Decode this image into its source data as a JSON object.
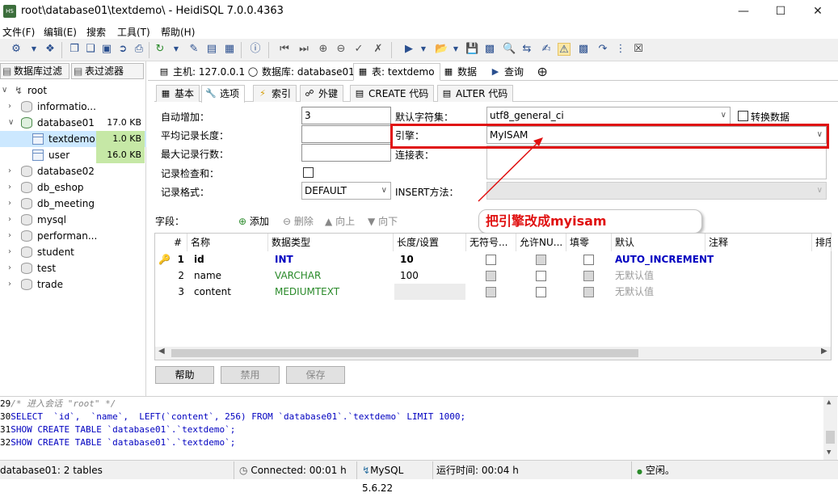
{
  "window": {
    "title": "root\\database01\\textdemo\\ - HeidiSQL 7.0.0.4363",
    "icon": "HS"
  },
  "menu": [
    "文件(F)",
    "编辑(E)",
    "搜索",
    "工具(T)",
    "帮助(H)"
  ],
  "filters": {
    "db_filter": "数据库过滤",
    "table_filter": "表过滤器"
  },
  "tree": [
    {
      "label": "root"
    },
    {
      "label": "informatio...",
      "size": ""
    },
    {
      "label": "database01",
      "size": "17.0 KB"
    },
    {
      "label": "textdemo",
      "size": "1.0 KB"
    },
    {
      "label": "user",
      "size": "16.0 KB"
    },
    {
      "label": "database02",
      "size": ""
    },
    {
      "label": "db_eshop",
      "size": ""
    },
    {
      "label": "db_meeting",
      "size": ""
    },
    {
      "label": "mysql",
      "size": ""
    },
    {
      "label": "performan...",
      "size": ""
    },
    {
      "label": "student",
      "size": ""
    },
    {
      "label": "test",
      "size": ""
    },
    {
      "label": "trade",
      "size": ""
    }
  ],
  "main_tabs": [
    "主机: 127.0.0.1",
    "数据库: database01",
    "表: textdemo",
    "数据",
    "查询"
  ],
  "sub_tabs": [
    "基本",
    "选项",
    "索引",
    "外键",
    "CREATE 代码",
    "ALTER 代码"
  ],
  "options": {
    "auto_increment_label": "自动增加：",
    "auto_increment_value": "3",
    "avg_row_label": "平均记录长度：",
    "max_rows_label": "最大记录行数：",
    "checksum_label": "记录检查和：",
    "row_format_label": "记录格式：",
    "row_format_value": "DEFAULT",
    "charset_label": "默认字符集：",
    "charset_value": "utf8_general_ci",
    "convert_label": "转换数据",
    "engine_label": "引擎：",
    "engine_value": "MyISAM",
    "union_label": "连接表：",
    "insert_method_label": "INSERT方法："
  },
  "annotation": {
    "text": "把引擎改成myisam",
    "color": "#ff0000"
  },
  "fields_toolbar": {
    "label": "字段：",
    "add": "添加",
    "remove": "删除",
    "up": "向上",
    "down": "向下"
  },
  "grid": {
    "headers": [
      "#",
      "名称",
      "数据类型",
      "长度/设置",
      "无符号...",
      "允许NU...",
      "填零",
      "默认",
      "注释",
      "排序"
    ],
    "rows": [
      {
        "num": "1",
        "name": "id",
        "type": "INT",
        "length": "10",
        "default": "AUTO_INCREMENT"
      },
      {
        "num": "2",
        "name": "name",
        "type": "VARCHAR",
        "length": "100",
        "default": "无默认值"
      },
      {
        "num": "3",
        "name": "content",
        "type": "MEDIUMTEXT",
        "length": "",
        "default": "无默认值"
      }
    ]
  },
  "buttons": {
    "help": "帮助",
    "discard": "禁用",
    "save": "保存"
  },
  "sql_log": [
    {
      "n": "29",
      "text": "/* 进入会话 \"root\" */"
    },
    {
      "n": "30",
      "text": "SELECT  `id`,  `name`,  LEFT(`content`, 256) FROM `database01`.`textdemo` LIMIT 1000;"
    },
    {
      "n": "31",
      "text": "SHOW CREATE TABLE `database01`.`textdemo`;"
    },
    {
      "n": "32",
      "text": "SHOW CREATE TABLE `database01`.`textdemo`;"
    }
  ],
  "status": {
    "tables": "database01: 2 tables",
    "connected": "Connected: 00:01 h",
    "version": "MySQL 5.6.22",
    "runtime": "运行时间: 00:04 h",
    "idle": "空闲。"
  }
}
